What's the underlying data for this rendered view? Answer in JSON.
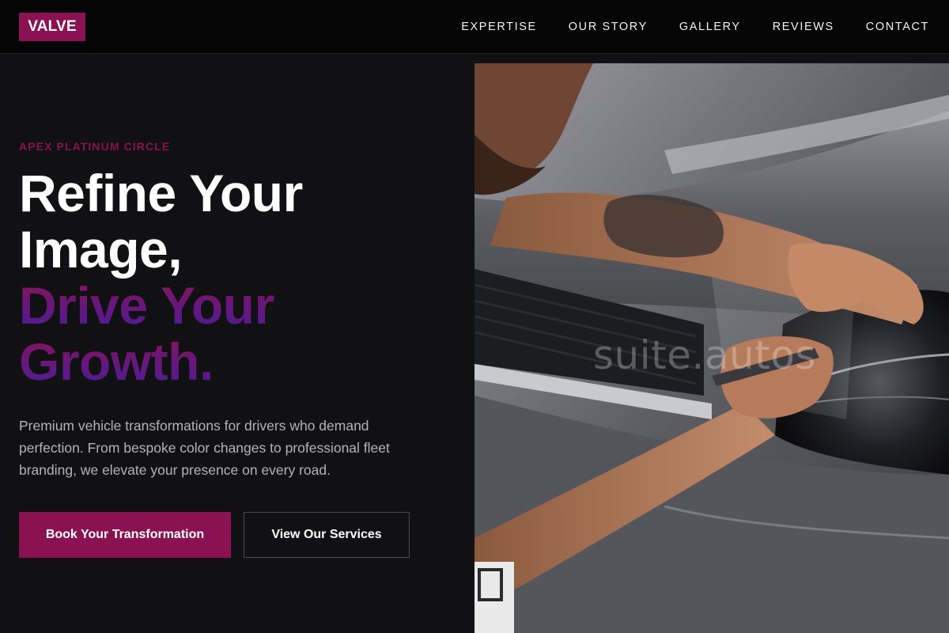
{
  "brand": {
    "name": "VALVE",
    "color": "#8a1252"
  },
  "nav": {
    "items": [
      {
        "label": "EXPERTISE"
      },
      {
        "label": "OUR STORY"
      },
      {
        "label": "GALLERY"
      },
      {
        "label": "REVIEWS"
      },
      {
        "label": "CONTACT"
      }
    ]
  },
  "hero": {
    "kicker": "APEX PLATINUM CIRCLE",
    "headline_white": [
      "Refine Your",
      "Image,"
    ],
    "headline_gradient": [
      "Drive Your",
      "Growth."
    ],
    "description": "Premium vehicle transformations for drivers who demand perfection. From bespoke color changes to professional fleet branding, we elevate your presence on every road.",
    "primary_cta": "Book Your Transformation",
    "secondary_cta": "View Our Services",
    "image_alt": "technician applying protective film to car headlight",
    "watermark": "suite.autos"
  },
  "colors": {
    "accent": "#8a1252",
    "gradient_end": "#4a1d96",
    "background": "#111113",
    "header": "#050505"
  }
}
